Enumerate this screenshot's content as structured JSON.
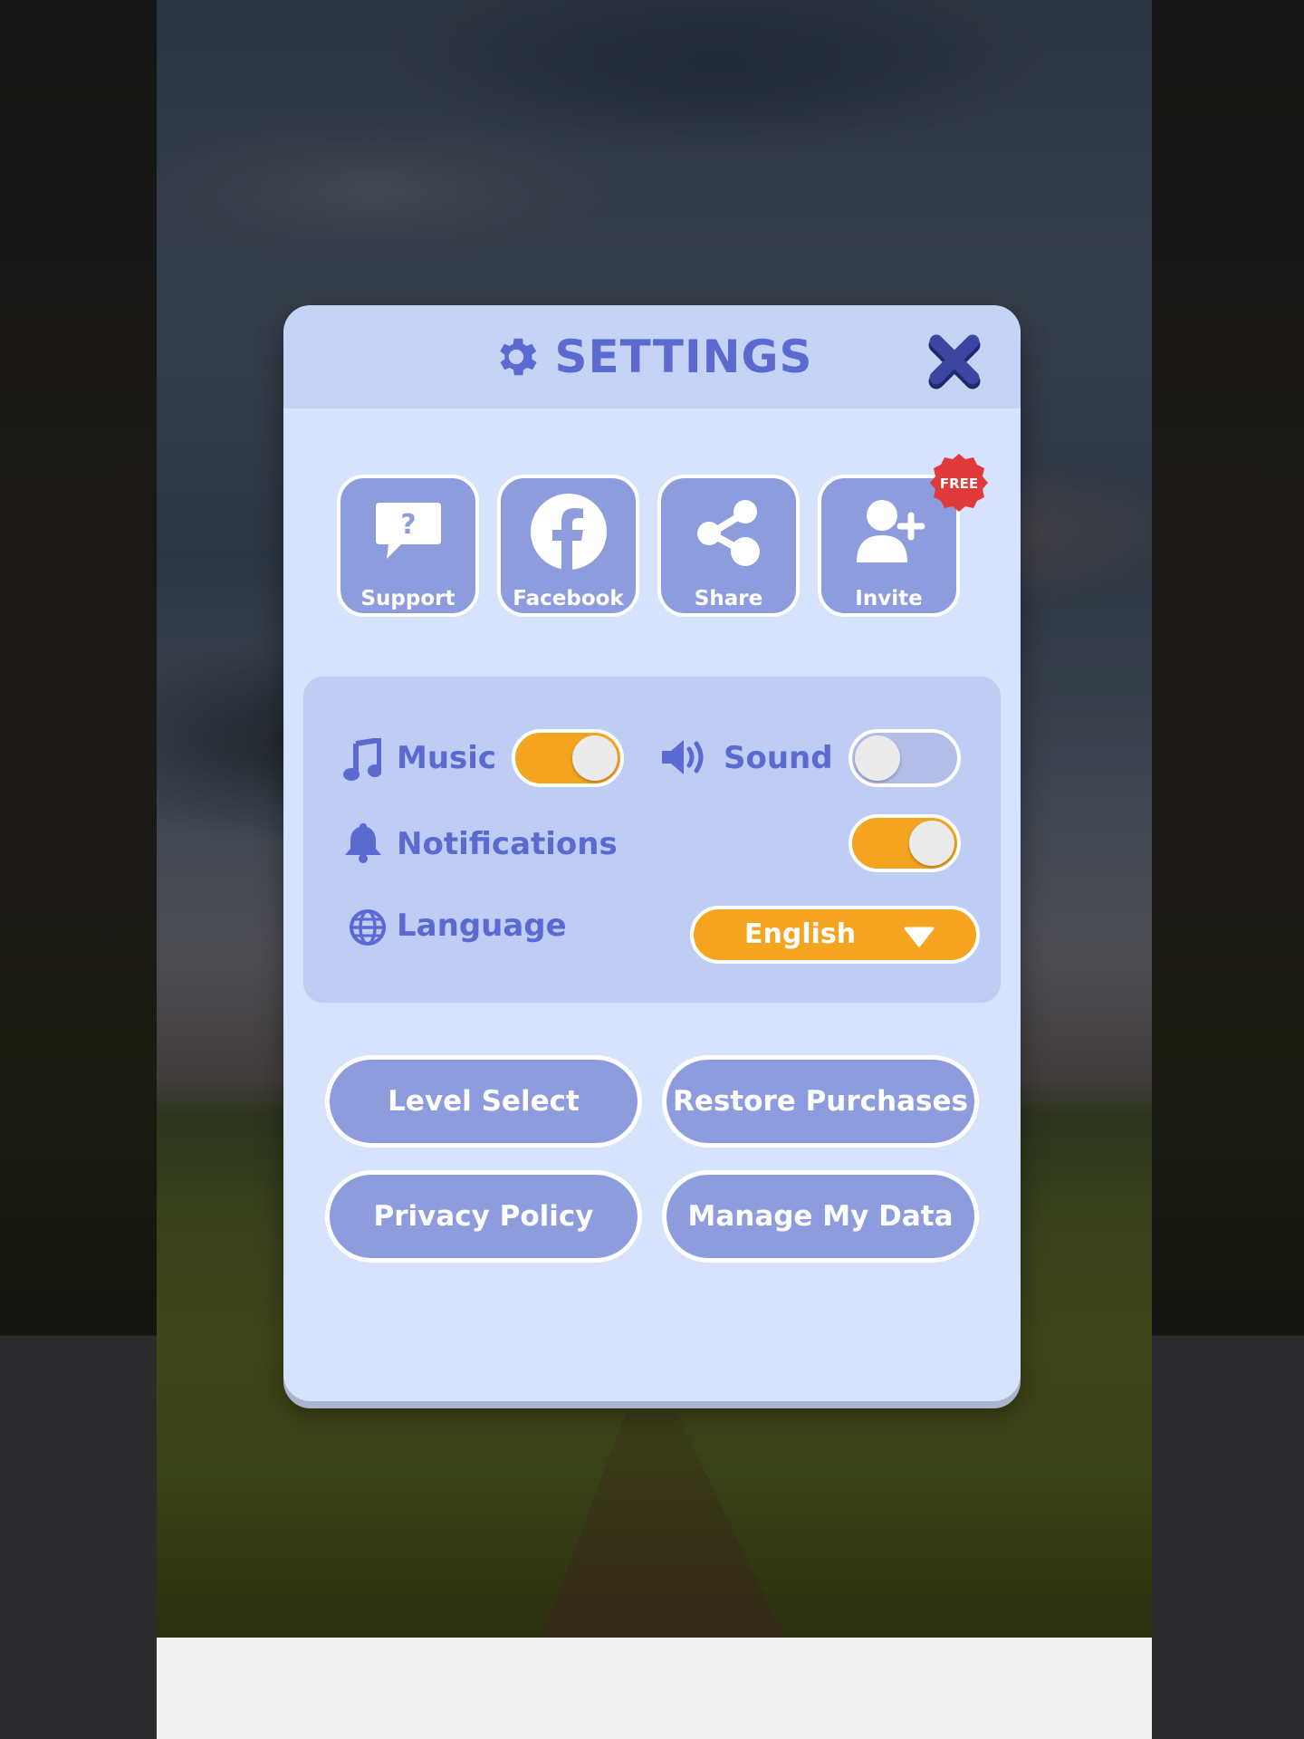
{
  "dialog": {
    "title": "SETTINGS"
  },
  "social_buttons": [
    {
      "label": "Support",
      "icon": "support-bubble-icon"
    },
    {
      "label": "Facebook",
      "icon": "facebook-icon"
    },
    {
      "label": "Share",
      "icon": "share-icon"
    },
    {
      "label": "Invite",
      "icon": "add-user-icon"
    }
  ],
  "invite_badge": "FREE",
  "settings": {
    "music": {
      "label": "Music",
      "enabled": true
    },
    "sound": {
      "label": "Sound",
      "enabled": false
    },
    "notifications": {
      "label": "Notifications",
      "enabled": true
    },
    "language": {
      "label": "Language",
      "value": "English"
    }
  },
  "actions": {
    "level_select": "Level Select",
    "restore_purchases": "Restore Purchases",
    "privacy_policy": "Privacy Policy",
    "manage_my_data": "Manage My Data"
  },
  "colors": {
    "accent": "#5a6ad0",
    "button": "#8c9cdd",
    "toggle_on": "#f4a41e",
    "toggle_off": "#b3bde8",
    "badge": "#e03a3a"
  }
}
